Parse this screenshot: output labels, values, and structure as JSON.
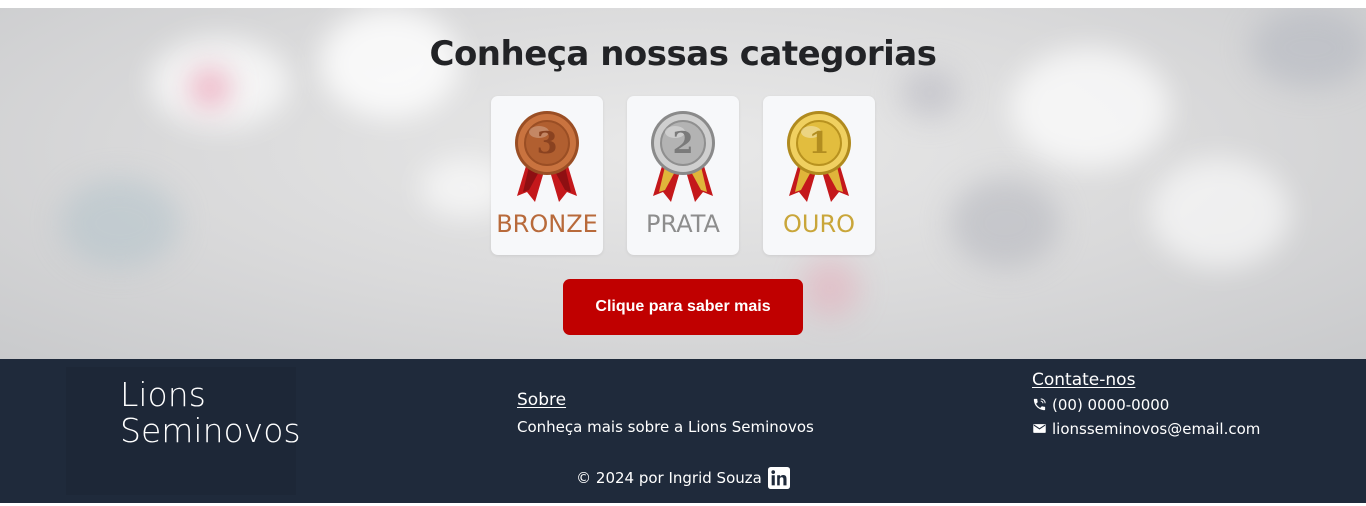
{
  "hero": {
    "title": "Conheça nossas categorias",
    "cta_label": "Clique para saber mais"
  },
  "categories": [
    {
      "number": "3",
      "label": "BRONZE",
      "color": "#b86a3b",
      "icon": "bronze-medal-icon"
    },
    {
      "number": "2",
      "label": "PRATA",
      "color": "#8d8d8d",
      "icon": "silver-medal-icon"
    },
    {
      "number": "1",
      "label": "OURO",
      "color": "#c9a63a",
      "icon": "gold-medal-icon"
    }
  ],
  "footer": {
    "brand_line1": "Lions",
    "brand_line2": "Seminovos",
    "sobre_title": "Sobre",
    "sobre_text": "Conheça mais sobre a Lions Seminovos",
    "contato_title": "Contate-nos",
    "phone": "(00) 0000-0000",
    "email": "lionsseminovos@email.com",
    "copyright": "© 2024 por Ingrid Souza"
  },
  "colors": {
    "accent": "#c00000",
    "footer_bg": "#1f2a3b"
  }
}
